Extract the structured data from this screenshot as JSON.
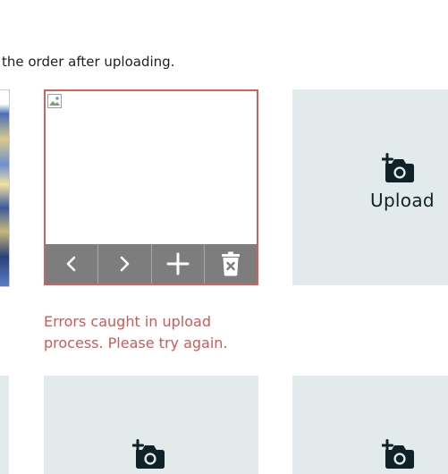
{
  "instruction": "the order after uploading.",
  "image_card": {
    "state": "error",
    "toolbar": {
      "prev_icon": "chevron-left-icon",
      "next_icon": "chevron-right-icon",
      "add_icon": "plus-icon",
      "delete_icon": "trash-icon"
    },
    "error_message": "Errors caught in upload process. Please try again."
  },
  "upload_slots": [
    {
      "label": "Upload",
      "icon": "camera-add-icon"
    },
    {
      "label": "",
      "icon": "camera-add-icon"
    },
    {
      "label": "",
      "icon": "camera-add-icon"
    }
  ],
  "colors": {
    "error": "#cf5a55",
    "slot_bg": "#e2eaeb",
    "toolbar_bg": "#7d7d7d",
    "icon_dark": "#0f2227"
  }
}
